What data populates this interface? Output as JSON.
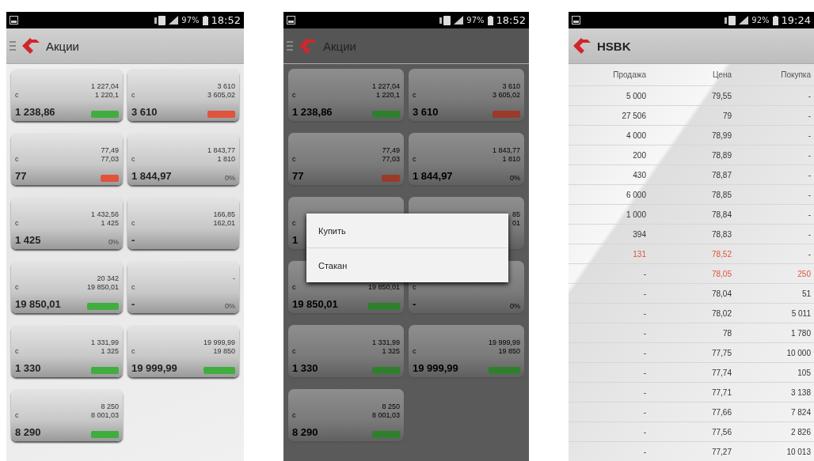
{
  "screens": [
    {
      "kind": "tiles",
      "dimmed": false,
      "status_bar": {
        "battery": "97%",
        "time": "18:52"
      },
      "title": "Акции",
      "tiles": [
        {
          "high": "1 227,04",
          "low": "1 220,1",
          "label": "c",
          "price": "1 238,86",
          "color": "#3fae3f"
        },
        {
          "high": "3 610",
          "low": "3 605,02",
          "label": "c",
          "price": "3 610",
          "color": "#e0533c"
        },
        {
          "high": "77,49",
          "low": "77,03",
          "label": "c",
          "price": "77",
          "color": "#e0533c"
        },
        {
          "high": "1 843,77",
          "low": "1 810",
          "label": "c",
          "price": "1 844,97",
          "change": "0%"
        },
        {
          "high": "1 432,56",
          "low": "1 425",
          "label": "c",
          "price": "1 425",
          "change": "0%"
        },
        {
          "high": "166,85",
          "low": "162,01",
          "label": "c",
          "price": "-"
        },
        {
          "high": "20 342",
          "low": "19 850,01",
          "label": "c",
          "price": "19 850,01",
          "color": "#3fae3f"
        },
        {
          "high": "-",
          "label": "c",
          "price": "-",
          "change": "0%"
        },
        {
          "high": "1 331,99",
          "low": "1 325",
          "label": "c",
          "price": "1 330",
          "color": "#3fae3f"
        },
        {
          "high": "19 999,99",
          "low": "19 850",
          "label": "c",
          "price": "19 999,99",
          "color": "#3fae3f"
        },
        {
          "high": "8 250",
          "low": "8 001,03",
          "label": "c",
          "price": "8 290",
          "color": "#3fae3f"
        }
      ]
    },
    {
      "kind": "tiles",
      "dimmed": true,
      "status_bar": {
        "battery": "97%",
        "time": "18:52"
      },
      "title": "Акции",
      "tiles": [
        {
          "high": "1 227,04",
          "low": "1 220,1",
          "label": "c",
          "price": "1 238,86",
          "color": "#2f7f2f"
        },
        {
          "high": "3 610",
          "low": "3 605,02",
          "label": "c",
          "price": "3 610",
          "color": "#9a3a2a"
        },
        {
          "high": "77,49",
          "low": "77,03",
          "label": "c",
          "price": "77",
          "color": "#9a3a2a"
        },
        {
          "high": "1 843,77",
          "low": "1 810",
          "label": "c",
          "price": "1 844,97",
          "change": "0%"
        },
        {
          "label": "c",
          "price": "1"
        },
        {
          "high": "85",
          "low": "01"
        },
        {
          "low": "19 850,01",
          "label": "c",
          "price": "19 850,01",
          "color": "#2f7f2f"
        },
        {
          "label": "c",
          "price": "-",
          "change": "0%"
        },
        {
          "high": "1 331,99",
          "low": "1 325",
          "label": "c",
          "price": "1 330",
          "color": "#2f7f2f"
        },
        {
          "high": "19 999,99",
          "low": "19 850",
          "label": "c",
          "price": "19 999,99",
          "color": "#2f7f2f"
        },
        {
          "high": "8 250",
          "low": "8 001,03",
          "label": "c",
          "price": "8 290",
          "color": "#2f7f2f"
        }
      ],
      "menu": {
        "items": [
          "Купить",
          "Стакан"
        ]
      }
    },
    {
      "kind": "book",
      "status_bar": {
        "battery": "92%",
        "time": "19:24"
      },
      "title": "HSBK",
      "columns": [
        "Продажа",
        "Цена",
        "Покупка"
      ],
      "rows": [
        [
          {
            "text": "5 000"
          },
          {
            "text": "79,55"
          },
          {
            "text": "-"
          }
        ],
        [
          {
            "text": "27 506"
          },
          {
            "text": "79"
          },
          {
            "text": "-"
          }
        ],
        [
          {
            "text": "4 000"
          },
          {
            "text": "78,99"
          },
          {
            "text": "-"
          }
        ],
        [
          {
            "text": "200"
          },
          {
            "text": "78,89"
          },
          {
            "text": "-"
          }
        ],
        [
          {
            "text": "430"
          },
          {
            "text": "78,87"
          },
          {
            "text": "-"
          }
        ],
        [
          {
            "text": "6 000"
          },
          {
            "text": "78,85"
          },
          {
            "text": "-"
          }
        ],
        [
          {
            "text": "1 000"
          },
          {
            "text": "78,84"
          },
          {
            "text": "-"
          }
        ],
        [
          {
            "text": "394"
          },
          {
            "text": "78,83"
          },
          {
            "text": "-"
          }
        ],
        [
          {
            "text": "131",
            "highlight": true
          },
          {
            "text": "78,52",
            "highlight": true
          },
          {
            "text": "-"
          }
        ],
        [
          {
            "text": "-"
          },
          {
            "text": "78,05",
            "highlight": true
          },
          {
            "text": "250",
            "highlight": true
          }
        ],
        [
          {
            "text": "-"
          },
          {
            "text": "78,04"
          },
          {
            "text": "51"
          }
        ],
        [
          {
            "text": "-"
          },
          {
            "text": "78,02"
          },
          {
            "text": "5 011"
          }
        ],
        [
          {
            "text": "-"
          },
          {
            "text": "78"
          },
          {
            "text": "1 780"
          }
        ],
        [
          {
            "text": "-"
          },
          {
            "text": "77,75"
          },
          {
            "text": "10 000"
          }
        ],
        [
          {
            "text": "-"
          },
          {
            "text": "77,74"
          },
          {
            "text": "105"
          }
        ],
        [
          {
            "text": "-"
          },
          {
            "text": "77,71"
          },
          {
            "text": "3 138"
          }
        ],
        [
          {
            "text": "-"
          },
          {
            "text": "77,66"
          },
          {
            "text": "7 824"
          }
        ],
        [
          {
            "text": "-"
          },
          {
            "text": "77,56"
          },
          {
            "text": "2 826"
          }
        ],
        [
          {
            "text": "-"
          },
          {
            "text": "77,27"
          },
          {
            "text": "10 013"
          }
        ]
      ]
    }
  ]
}
